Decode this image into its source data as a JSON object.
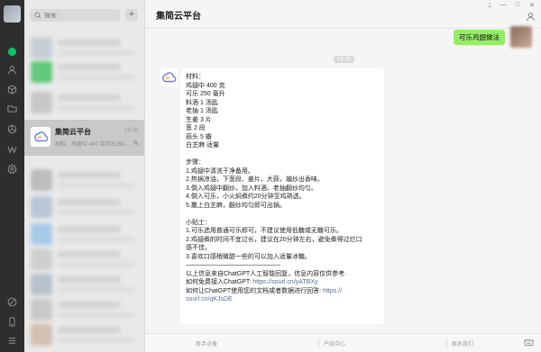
{
  "sidebar": {
    "icons": [
      "chat-icon",
      "contacts-icon",
      "favorites-icon",
      "folder-icon",
      "moments-icon",
      "miniprogram-icon",
      "settings-icon"
    ],
    "bottom_icons": [
      "phone-icon",
      "menu-icon"
    ]
  },
  "search": {
    "placeholder": "搜索",
    "add": "+"
  },
  "chat_list": {
    "active": {
      "name": "集简云平台",
      "time": "16:16",
      "preview": "材料：鸡翅中 400 克可乐250..."
    }
  },
  "header": {
    "title": "集简云平台"
  },
  "window_controls": {
    "pin": "⊥",
    "minimize": "—",
    "maximize": "□",
    "close": "✕"
  },
  "messages": {
    "outgoing": "可乐鸡翅做法",
    "timestamp": "16:16",
    "reply_lines": [
      "材料：",
      "鸡翅中 400 克",
      "可乐 250 毫升",
      "料酒 1 汤匙",
      "老抽 1 汤匙",
      "生姜 3 片",
      "葱 2 段",
      "蒜头 5 瓣",
      "白芝麻 适量",
      "",
      "步骤：",
      "1.鸡翅中清洗干净备用。",
      "2.热锅凉油，下葱段、姜片、大蒜，煸炒出香味。",
      "3.倒入鸡翅中翻炒，加入料酒、老抽翻炒均匀。",
      "4.倒入可乐，小火焖煮约20分钟至鸡熟透。",
      "5.撒上白芝麻，翻炒均匀即可出锅。",
      "",
      "小贴士：",
      "1.可乐选用普通可乐即可，不建议使用低糖或无糖可乐。",
      "2.鸡翅煮的时间不宜过长，建议在20分钟左右，避免煮得过烂口",
      "感不佳。",
      "3.喜欢口感稍微甜一些的可以加入适量冰糖。",
      "———————————————",
      "以上信息来自ChatGPT人工智能回复，信息内容仅供参考."
    ],
    "link1_prefix": "如何免费接入ChatGPT: ",
    "link1": "https://sourl.cn/yATBXy",
    "link2_prefix": "如何让ChatGPT使用您的文档或者数据进行回答: ",
    "link2_a": "https://",
    "link2_b": "sourl.cn/qKJsDE"
  },
  "footer": {
    "items": [
      "新手必备",
      "产品中心",
      "联系我们"
    ]
  }
}
